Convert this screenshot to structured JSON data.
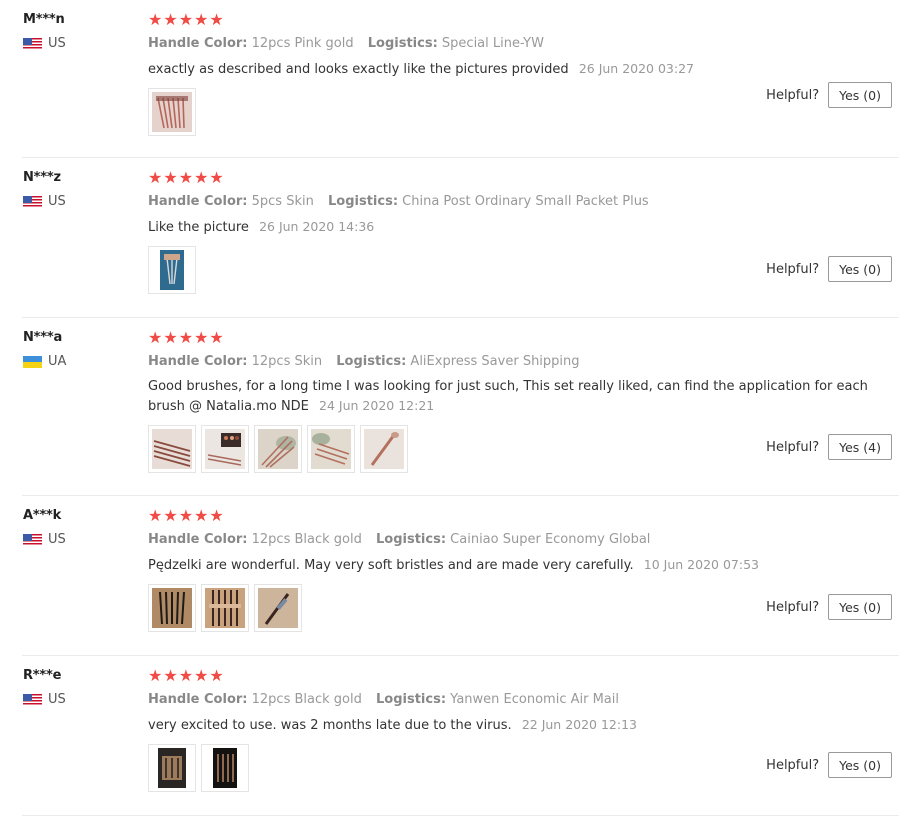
{
  "reviews": [
    {
      "name": "M***n",
      "country": "US",
      "flag": "us",
      "stars": 5,
      "handle_label": "Handle Color:",
      "handle_value": "12pcs Pink gold",
      "logistics_label": "Logistics:",
      "logistics_value": "Special Line-YW",
      "text": "exactly as described and looks exactly like the pictures provided",
      "date": "26 Jun 2020 03:27",
      "photo_count": 1,
      "helpful_label": "Helpful?",
      "yes_label": "Yes (0)"
    },
    {
      "name": "N***z",
      "country": "US",
      "flag": "us",
      "stars": 5,
      "handle_label": "Handle Color:",
      "handle_value": "5pcs Skin",
      "logistics_label": "Logistics:",
      "logistics_value": "China Post Ordinary Small Packet Plus",
      "text": "Like the picture",
      "date": "26 Jun 2020 14:36",
      "photo_count": 1,
      "helpful_label": "Helpful?",
      "yes_label": "Yes (0)"
    },
    {
      "name": "N***a",
      "country": "UA",
      "flag": "ua",
      "stars": 5,
      "handle_label": "Handle Color:",
      "handle_value": "12pcs Skin",
      "logistics_label": "Logistics:",
      "logistics_value": "AliExpress Saver Shipping",
      "text": "Good brushes, for a long time I was looking for just such, This set really liked, can find the application for each brush @ Natalia.mo NDE",
      "date": "24 Jun 2020 12:21",
      "photo_count": 5,
      "helpful_label": "Helpful?",
      "yes_label": "Yes (4)"
    },
    {
      "name": "A***k",
      "country": "US",
      "flag": "us",
      "stars": 5,
      "handle_label": "Handle Color:",
      "handle_value": "12pcs Black gold",
      "logistics_label": "Logistics:",
      "logistics_value": "Cainiao Super Economy Global",
      "text": "Pędzelki are wonderful. May very soft bristles and are made very carefully.",
      "date": "10 Jun 2020 07:53",
      "photo_count": 3,
      "helpful_label": "Helpful?",
      "yes_label": "Yes (0)"
    },
    {
      "name": "R***e",
      "country": "US",
      "flag": "us",
      "stars": 5,
      "handle_label": "Handle Color:",
      "handle_value": "12pcs Black gold",
      "logistics_label": "Logistics:",
      "logistics_value": "Yanwen Economic Air Mail",
      "text": "very excited to use. was 2 months late due to the virus.",
      "date": "22 Jun 2020 12:13",
      "photo_count": 2,
      "helpful_label": "Helpful?",
      "yes_label": "Yes (0)"
    }
  ],
  "star_icon": "star-icon",
  "colors": {
    "star": "#f04b45",
    "muted": "#999999",
    "divider": "#ebebeb"
  }
}
